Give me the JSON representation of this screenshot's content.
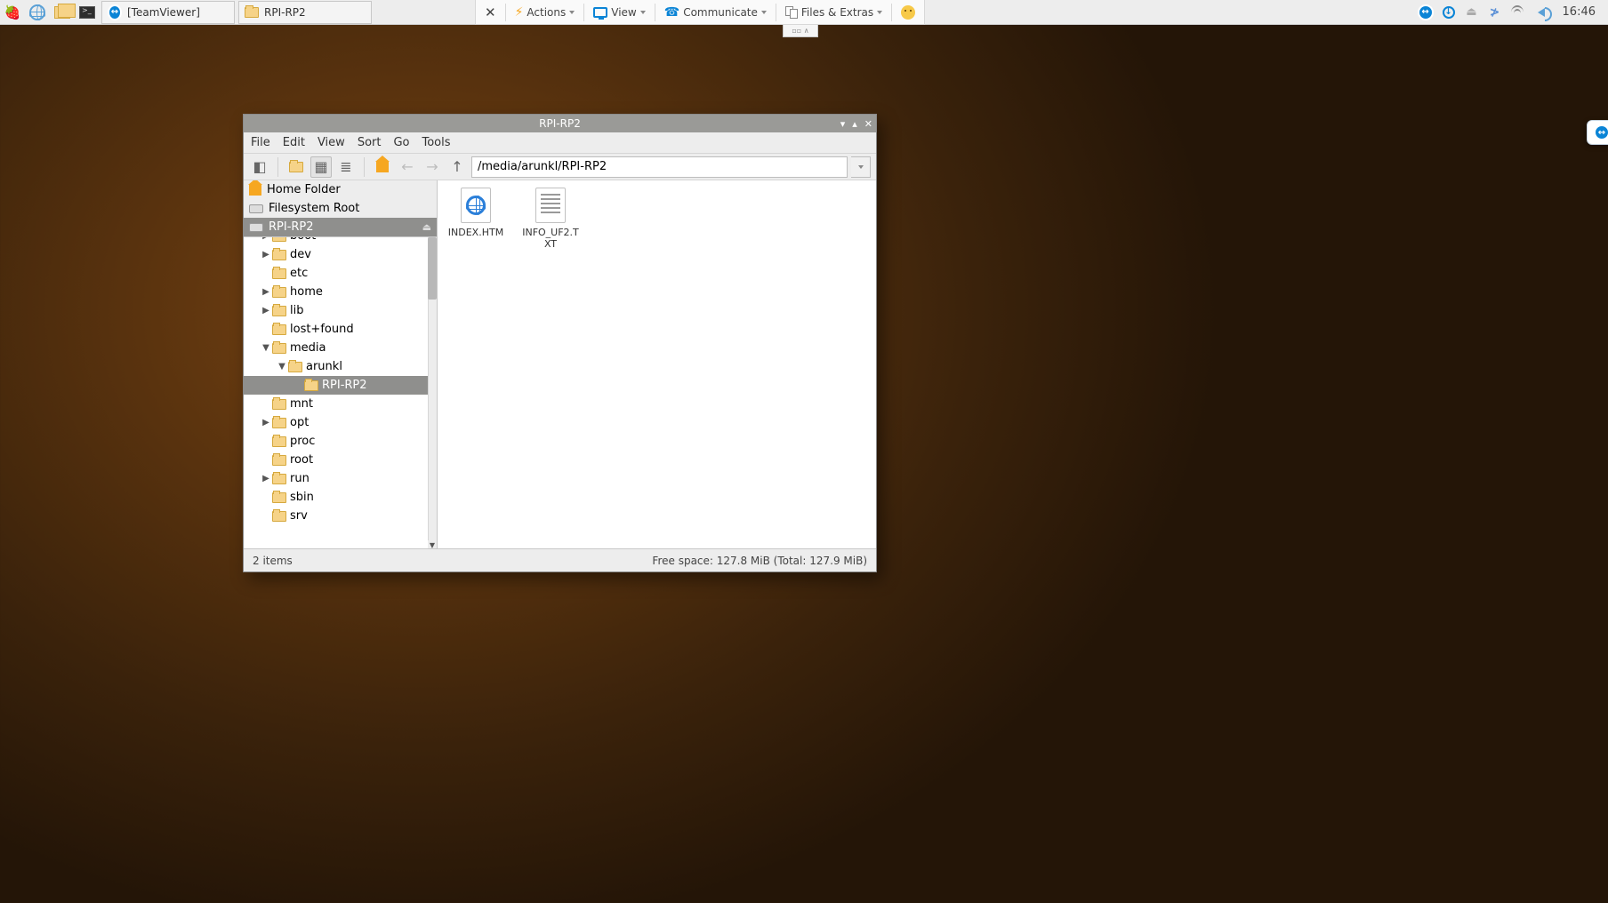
{
  "taskbar": {
    "tasks": [
      {
        "icon": "teamviewer",
        "label": "[TeamViewer]"
      },
      {
        "icon": "folder",
        "label": "RPI-RP2"
      }
    ],
    "clock": "16:46"
  },
  "tv_toolbar": {
    "close": "✕",
    "actions": "Actions",
    "view": "View",
    "communicate": "Communicate",
    "files": "Files & Extras"
  },
  "fm": {
    "title": "RPI-RP2",
    "menu": {
      "file": "File",
      "edit": "Edit",
      "view": "View",
      "sort": "Sort",
      "go": "Go",
      "tools": "Tools"
    },
    "address": "/media/arunkl/RPI-RP2",
    "places": {
      "home": "Home Folder",
      "root": "Filesystem Root",
      "drive": "RPI-RP2"
    },
    "tree": [
      {
        "indent": 1,
        "expand": "▶",
        "label": "boot",
        "cut": true
      },
      {
        "indent": 1,
        "expand": "▶",
        "label": "dev"
      },
      {
        "indent": 1,
        "expand": "",
        "label": "etc"
      },
      {
        "indent": 1,
        "expand": "▶",
        "label": "home"
      },
      {
        "indent": 1,
        "expand": "▶",
        "label": "lib"
      },
      {
        "indent": 1,
        "expand": "",
        "label": "lost+found"
      },
      {
        "indent": 1,
        "expand": "▼",
        "label": "media"
      },
      {
        "indent": 2,
        "expand": "▼",
        "label": "arunkl"
      },
      {
        "indent": 3,
        "expand": "",
        "label": "RPI-RP2",
        "sel": true
      },
      {
        "indent": 1,
        "expand": "",
        "label": "mnt"
      },
      {
        "indent": 1,
        "expand": "▶",
        "label": "opt"
      },
      {
        "indent": 1,
        "expand": "",
        "label": "proc"
      },
      {
        "indent": 1,
        "expand": "",
        "label": "root"
      },
      {
        "indent": 1,
        "expand": "▶",
        "label": "run"
      },
      {
        "indent": 1,
        "expand": "",
        "label": "sbin"
      },
      {
        "indent": 1,
        "expand": "",
        "label": "srv"
      }
    ],
    "files": [
      {
        "icon": "htm",
        "name": "INDEX.HTM"
      },
      {
        "icon": "txt",
        "name": "INFO_UF2.TXT"
      }
    ],
    "status_left": "2 items",
    "status_right": "Free space: 127.8 MiB (Total: 127.9 MiB)"
  }
}
